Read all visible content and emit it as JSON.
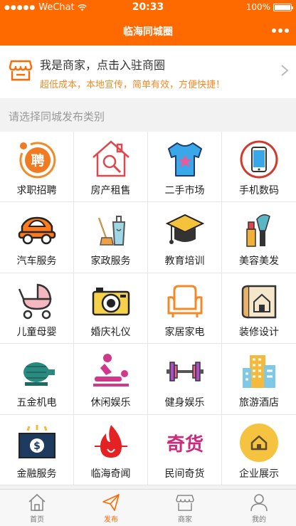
{
  "status_bar": {
    "carrier": "WeChat",
    "time": "20:33",
    "battery": "100%"
  },
  "nav": {
    "title": "临海同城圈"
  },
  "merchant": {
    "title": "我是商家，点击入驻商圈",
    "subtitle": "超低成本，本地宣传，简单有效，方便快捷！"
  },
  "section_label": "请选择同城发布类别",
  "categories": [
    {
      "label": "求职招聘",
      "icon": "hiring-icon"
    },
    {
      "label": "房产租售",
      "icon": "house-icon"
    },
    {
      "label": "二手市场",
      "icon": "tshirt-icon"
    },
    {
      "label": "手机数码",
      "icon": "phone-icon"
    },
    {
      "label": "汽车服务",
      "icon": "car-icon"
    },
    {
      "label": "家政服务",
      "icon": "cleaning-icon"
    },
    {
      "label": "教育培训",
      "icon": "graduation-cap-icon"
    },
    {
      "label": "美容美发",
      "icon": "makeup-icon"
    },
    {
      "label": "儿童母婴",
      "icon": "stroller-icon"
    },
    {
      "label": "婚庆礼仪",
      "icon": "camera-icon"
    },
    {
      "label": "家居家电",
      "icon": "sofa-icon"
    },
    {
      "label": "装修设计",
      "icon": "blueprint-icon"
    },
    {
      "label": "五金机电",
      "icon": "motor-icon"
    },
    {
      "label": "休闲娱乐",
      "icon": "massage-icon"
    },
    {
      "label": "健身娱乐",
      "icon": "dumbbell-icon"
    },
    {
      "label": "旅游酒店",
      "icon": "hotel-icon"
    },
    {
      "label": "金融服务",
      "icon": "money-icon"
    },
    {
      "label": "临海奇闻",
      "icon": "flame-icon"
    },
    {
      "label": "民间奇货",
      "icon": "rare-goods-icon"
    },
    {
      "label": "企业展示",
      "icon": "enterprise-icon"
    }
  ],
  "tabs": [
    {
      "label": "首页",
      "icon": "home-icon",
      "active": false
    },
    {
      "label": "发布",
      "icon": "send-icon",
      "active": true
    },
    {
      "label": "商家",
      "icon": "shop-icon",
      "active": false
    },
    {
      "label": "我的",
      "icon": "user-icon",
      "active": false
    }
  ],
  "colors": {
    "accent": "#ff6a00",
    "subtitle": "#f28a28"
  },
  "icon_glyphs": {
    "hiring": "聘",
    "rare_goods": "奇货"
  }
}
